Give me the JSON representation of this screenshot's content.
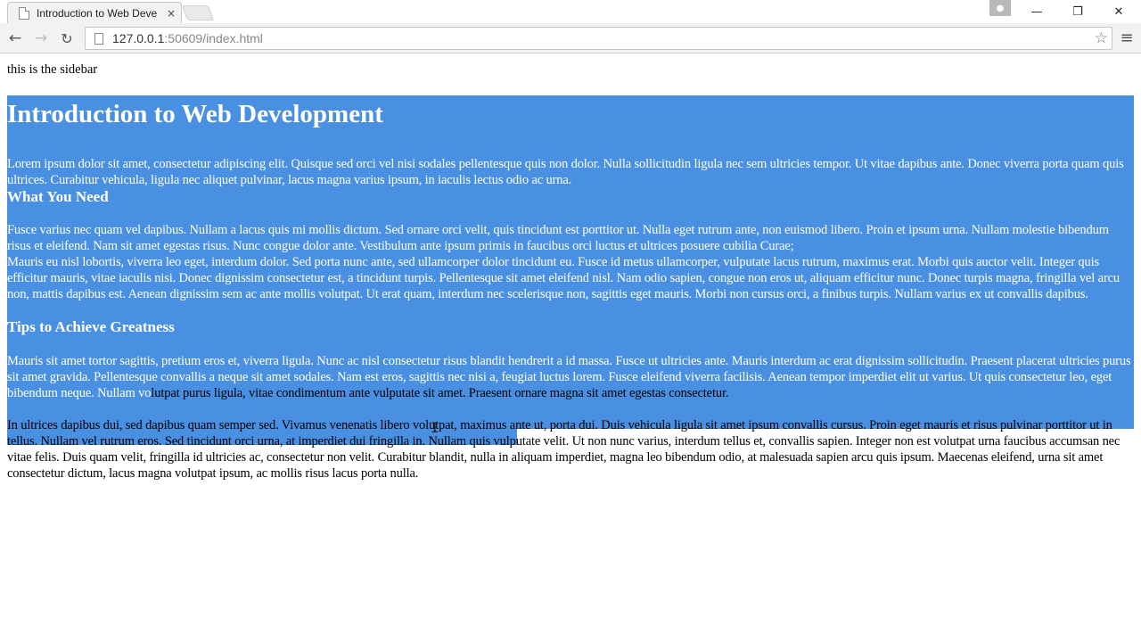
{
  "browser": {
    "tab_title": "Introduction to Web Deve",
    "tab_close": "×",
    "url_host": "127.0.0.1",
    "url_rest": ":50609/index.html",
    "window": {
      "minimize": "—",
      "maximize": "❐",
      "close": "✕"
    },
    "profile_icon": "person-icon",
    "star_icon": "☆",
    "menu_icon": "≡",
    "back": "←",
    "forward": "→",
    "reload": "↻"
  },
  "page": {
    "sidebar_text": "this is the sidebar",
    "title": "Introduction to Web Development",
    "intro": "Lorem ipsum dolor sit amet, consectetur adipiscing elit. Quisque sed orci vel nisi sodales pellentesque quis non dolor. Nulla sollicitudin ligula nec sem ultricies tempor. Ut vitae dapibus ante. Donec viverra porta quam quis ultrices. Curabitur vehicula, ligula nec aliquet pulvinar, lacus magna varius ipsum, in iaculis lectus odio ac urna.",
    "heading_need": "What You Need",
    "need_p1": "Fusce varius nec quam vel dapibus. Nullam a lacus quis mi mollis dictum. Sed ornare orci velit, quis tincidunt est porttitor ut. Nulla eget rutrum ante, non euismod libero. Proin et ipsum urna. Nullam molestie bibendum risus et eleifend. Nam sit amet egestas risus. Nunc congue dolor ante. Vestibulum ante ipsum primis in faucibus orci luctus et ultrices posuere cubilia Curae;",
    "need_p2": "Mauris eu nisl lobortis, viverra leo eget, interdum dolor. Sed porta nunc ante, sed ullamcorper dolor tincidunt eu. Fusce id metus ullamcorper, vulputate lacus rutrum, maximus erat. Morbi quis auctor velit. Integer quis efficitur mauris, vitae iaculis nisi. Donec dignissim consectetur est, a tincidunt turpis. Pellentesque sit amet eleifend nisl. Nam odio sapien, congue non eros ut, aliquam efficitur nunc. Donec turpis magna, fringilla vel arcu non, mattis dapibus est. Aenean dignissim sem ac ante mollis volutpat. Ut erat quam, interdum nec scelerisque non, sagittis eget mauris. Morbi non cursus orci, a finibus turpis. Nullam varius ex ut convallis dapibus.",
    "heading_tips": "Tips to Achieve Greatness",
    "tips_p1_selected": "Mauris sit amet tortor sagittis, pretium eros et, viverra ligula. Nunc ac nisl consectetur risus blandit hendrerit a id massa. Fusce ut ultricies ante. Mauris interdum ac erat dignissim sollicitudin. Praesent placerat ultricies purus sit amet gravida. Pellentesque convallis a neque sit amet sodales. Nam est eros, sagittis nec nisi a, feugiat luctus lorem. Fusce eleifend viverra facilisis. Aenean tempor imperdiet elit ut varius. Ut quis consectetur leo, eget bibendum neque. Nullam vo",
    "tips_p1_rest": "lutpat purus ligula, vitae condimentum ante vulputate sit amet. Praesent ornare magna sit amet egestas consectetur.",
    "tips_p2": "In ultrices dapibus dui, sed dapibus quam semper sed. Vivamus venenatis libero volutpat, maximus ante ut, porta dui. Duis vehicula ligula sit amet ipsum convallis cursus. Proin eget mauris et risus pulvinar porttitor ut in tellus. Nullam vel rutrum eros. Sed tincidunt orci urna, at imperdiet dui fringilla in. Nullam quis vulputate velit. Ut non nunc varius, interdum tellus et, convallis sapien. Integer non est volutpat urna faucibus accumsan nec vitae felis. Duis quam velit, fringilla id ultricies ac, consectetur non velit. Curabitur blandit, nulla in aliquam imperdiet, magna leo bibendum odio, at malesuada sapien arcu quis ipsum. Maecenas eleifend, urna sit amet consectetur dictum, lacus magna volutpat ipsum, ac mollis risus lacus porta nulla."
  },
  "colors": {
    "selection": "#4a90e2",
    "toolbar": "#f2f2f2"
  }
}
